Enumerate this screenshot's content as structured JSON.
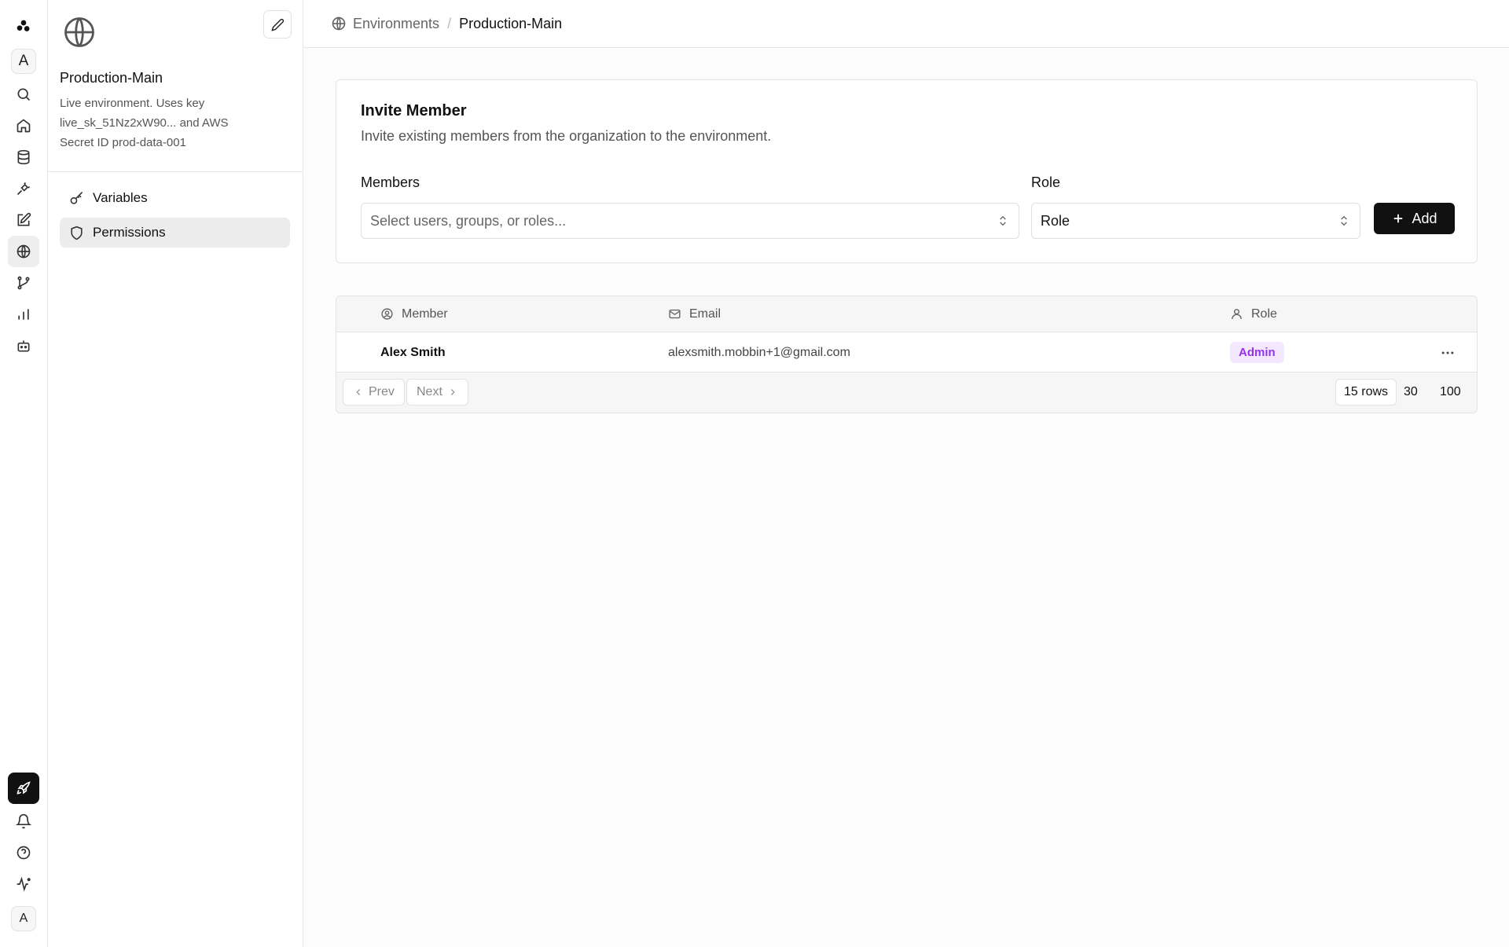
{
  "rail": {
    "workspace_initial": "A",
    "user_initial": "A",
    "top_icons": [
      "logo-icon",
      "search-icon",
      "home-icon",
      "database-icon",
      "plug-icon",
      "edit-icon",
      "globe-icon",
      "branch-icon",
      "chart-icon",
      "bot-icon"
    ],
    "bottom_icons": [
      "rocket-icon",
      "bell-icon",
      "help-icon",
      "activity-icon"
    ],
    "active_item": "globe-icon"
  },
  "environment": {
    "name": "Production-Main",
    "description": "Live environment. Uses key live_sk_51Nz2xW90... and AWS Secret ID prod-data-001",
    "nav": [
      {
        "label": "Variables",
        "icon": "key-icon",
        "active": false
      },
      {
        "label": "Permissions",
        "icon": "shield-icon",
        "active": true
      }
    ]
  },
  "breadcrumb": {
    "parent": "Environments",
    "separator": "/",
    "current": "Production-Main"
  },
  "invite": {
    "title": "Invite Member",
    "subtitle": "Invite existing members from the organization to the environment.",
    "members_label": "Members",
    "members_placeholder": "Select users, groups, or roles...",
    "role_label": "Role",
    "role_value": "Role",
    "add_label": "Add"
  },
  "table": {
    "columns": [
      {
        "label": "Member",
        "icon": "user-circle-icon"
      },
      {
        "label": "Email",
        "icon": "mail-icon"
      },
      {
        "label": "Role",
        "icon": "user-icon"
      }
    ],
    "rows": [
      {
        "name": "Alex Smith",
        "email": "alexsmith.mobbin+1@gmail.com",
        "role": "Admin"
      }
    ],
    "pagination": {
      "prev_label": "Prev",
      "next_label": "Next",
      "row_options": [
        "15 rows",
        "30",
        "100"
      ],
      "selected": "15 rows"
    }
  },
  "colors": {
    "primary_button": "#111111",
    "badge_bg": "#f3e8ff",
    "badge_text": "#9333ea"
  }
}
